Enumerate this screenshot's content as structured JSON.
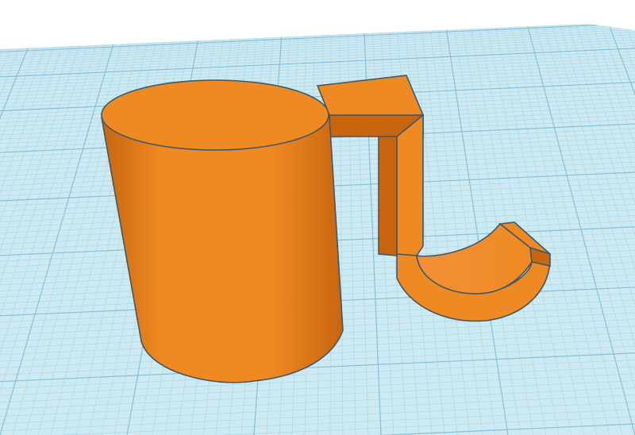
{
  "scene": {
    "background_color": "#ffffff",
    "workplane_color": "#cdeaf3",
    "grid_minor_color": "#a9d3e3",
    "grid_major_color": "#87bfd6",
    "object_color": "#ef8a22",
    "object_shade_color": "#c8650f",
    "object_highlight_color": "#f29038",
    "edge_color": "#3f5868"
  }
}
